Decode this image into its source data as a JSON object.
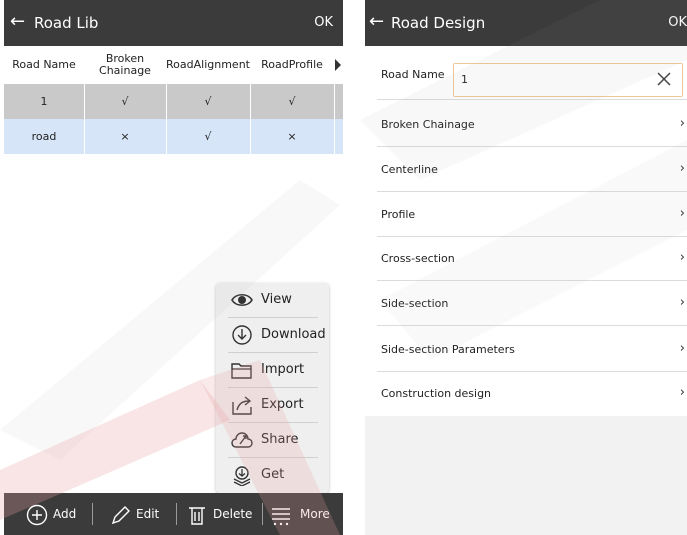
{
  "left": {
    "appbar": {
      "back_glyph": "←",
      "title": "Road Lib",
      "ok": "OK"
    },
    "table": {
      "columns": [
        "Road Name",
        "Broken Chainage",
        "RoadAlignment",
        "RoadProfile"
      ],
      "rows": [
        [
          "1",
          "√",
          "√",
          "√"
        ],
        [
          "road",
          "×",
          "√",
          "×"
        ]
      ]
    },
    "popup_menu": [
      {
        "label": "View",
        "icon": "eye-icon"
      },
      {
        "label": "Download",
        "icon": "download-icon"
      },
      {
        "label": "Import",
        "icon": "folder-icon"
      },
      {
        "label": "Export",
        "icon": "export-icon"
      },
      {
        "label": "Share",
        "icon": "cloud-share-icon"
      },
      {
        "label": "Get",
        "icon": "get-icon"
      }
    ],
    "bottom_bar": [
      {
        "label": "Add",
        "icon": "plus-circle-icon"
      },
      {
        "label": "Edit",
        "icon": "pencil-icon"
      },
      {
        "label": "Delete",
        "icon": "trash-icon"
      },
      {
        "label": "More",
        "icon": "more-menu-icon"
      }
    ]
  },
  "right": {
    "appbar": {
      "back_glyph": "←",
      "title": "Road Design",
      "ok": "OK"
    },
    "road_name": {
      "label": "Road Name",
      "value": "1"
    },
    "items": [
      "Broken Chainage",
      "Centerline",
      "Profile",
      "Cross-section",
      "Side-section",
      "Side-section Parameters",
      "Construction design"
    ],
    "chevron": "›"
  },
  "colors": {
    "appbar": "#3b3b3b",
    "selected_row": "#c9c9c9",
    "highlight_row": "#d6e5f7",
    "input_border": "#f0c79a",
    "watermark_red": "#e8a0a0"
  }
}
